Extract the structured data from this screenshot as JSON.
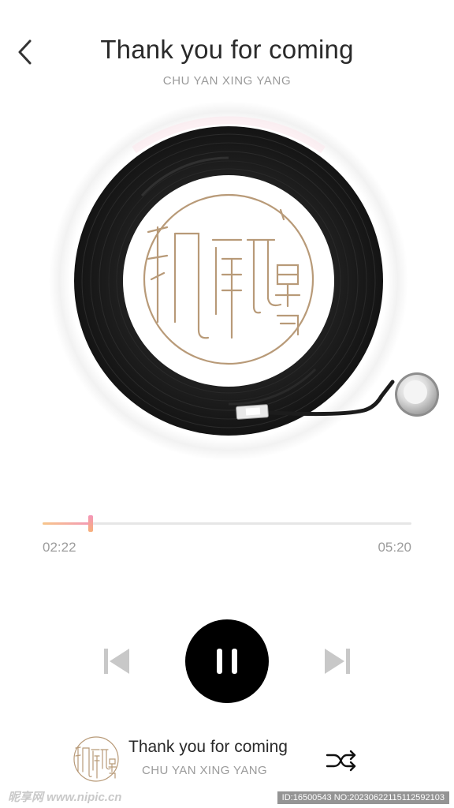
{
  "header": {
    "back_icon": "chevron-left-icon",
    "title": "Thank you for coming",
    "artist": "CHU YAN XING YANG"
  },
  "album": {
    "logo_text": "初颜星氧",
    "disc": "vinyl-record",
    "tonearm": "tonearm-icon"
  },
  "progress": {
    "current_time": "02:22",
    "total_time": "05:20",
    "fraction": 0.13
  },
  "controls": {
    "prev_icon": "skip-back-icon",
    "play_icon": "pause-icon",
    "next_icon": "skip-forward-icon"
  },
  "mini_player": {
    "title": "Thank you for coming",
    "artist": "CHU YAN XING YANG",
    "shuffle_icon": "shuffle-icon"
  },
  "watermark": {
    "left": "昵享网 www.nipic.cn",
    "right": "ID:16500543 NO:20230622115112592103"
  },
  "colors": {
    "progress_start": "#f7c58a",
    "progress_end": "#f39ab6",
    "logo_gold": "#b89a78",
    "play_button": "#000000"
  }
}
